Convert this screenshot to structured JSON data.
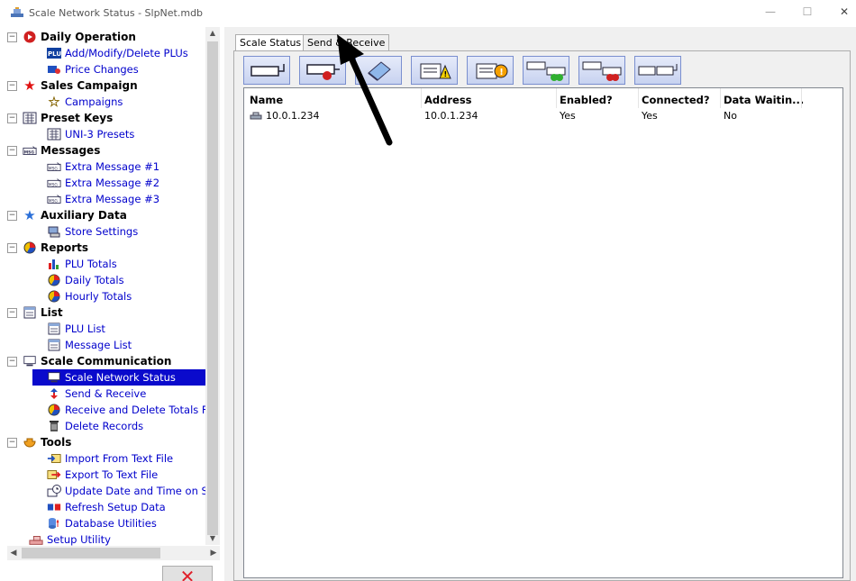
{
  "window": {
    "title": "Scale Network Status - SlpNet.mdb",
    "minimize": "—",
    "maximize": "☐",
    "close": "✕"
  },
  "tree": {
    "categories": [
      {
        "label": "Daily Operation",
        "icon": "play-icon",
        "children": [
          {
            "label": "Add/Modify/Delete PLUs",
            "icon": "plu-icon"
          },
          {
            "label": "Price Changes",
            "icon": "price-tag-icon"
          }
        ]
      },
      {
        "label": "Sales Campaign",
        "icon": "red-star-icon",
        "children": [
          {
            "label": "Campaigns",
            "icon": "yellow-star-icon"
          }
        ]
      },
      {
        "label": "Preset Keys",
        "icon": "keypad-icon",
        "children": [
          {
            "label": "UNI-3 Presets",
            "icon": "keypad-icon"
          }
        ]
      },
      {
        "label": "Messages",
        "icon": "message-icon",
        "children": [
          {
            "label": "Extra Message #1",
            "icon": "message-icon"
          },
          {
            "label": "Extra Message #2",
            "icon": "message-icon"
          },
          {
            "label": "Extra Message #3",
            "icon": "message-icon"
          }
        ]
      },
      {
        "label": "Auxiliary Data",
        "icon": "blue-star-icon",
        "children": [
          {
            "label": "Store Settings",
            "icon": "store-icon"
          }
        ]
      },
      {
        "label": "Reports",
        "icon": "pie-chart-icon",
        "children": [
          {
            "label": "PLU Totals",
            "icon": "bar-chart-icon"
          },
          {
            "label": "Daily Totals",
            "icon": "pie-chart-icon"
          },
          {
            "label": "Hourly Totals",
            "icon": "pie-chart-icon"
          }
        ]
      },
      {
        "label": "List",
        "icon": "list-icon",
        "children": [
          {
            "label": "PLU List",
            "icon": "list-icon"
          },
          {
            "label": "Message List",
            "icon": "list-icon"
          }
        ]
      },
      {
        "label": "Scale Communication",
        "icon": "network-icon",
        "children": [
          {
            "label": "Scale Network Status",
            "icon": "network-icon",
            "selected": true
          },
          {
            "label": "Send & Receive",
            "icon": "transfer-icon"
          },
          {
            "label": "Receive and Delete Totals F",
            "icon": "pie-chart-icon"
          },
          {
            "label": "Delete Records",
            "icon": "trash-icon"
          }
        ]
      },
      {
        "label": "Tools",
        "icon": "tools-icon",
        "children": [
          {
            "label": "Import From Text File",
            "icon": "import-icon"
          },
          {
            "label": "Export To Text File",
            "icon": "export-icon"
          },
          {
            "label": "Update Date and Time on S",
            "icon": "clock-icon"
          },
          {
            "label": "Refresh Setup Data",
            "icon": "refresh-icon"
          },
          {
            "label": "Database Utilities",
            "icon": "database-icon"
          }
        ]
      }
    ],
    "footer_item": {
      "label": "Setup Utility",
      "icon": "scale-icon"
    },
    "expander_symbol": "⊟"
  },
  "tabs": [
    {
      "label": "Scale Status",
      "active": true
    },
    {
      "label": "Send & Receive",
      "active": false
    }
  ],
  "toolbar": [
    {
      "icon": "scale-connect-icon"
    },
    {
      "icon": "scale-disconnect-icon"
    },
    {
      "icon": "eraser-icon"
    },
    {
      "icon": "warning-doc-icon"
    },
    {
      "icon": "alert-doc-icon"
    },
    {
      "icon": "scales-green-icon"
    },
    {
      "icon": "scales-red-icon"
    },
    {
      "icon": "scales-pair-icon"
    }
  ],
  "table": {
    "columns": [
      "Name",
      "Address",
      "Enabled?",
      "Connected?",
      "Data Waitin..."
    ],
    "rows": [
      [
        "10.0.1.234",
        "10.0.1.234",
        "Yes",
        "Yes",
        "No"
      ]
    ]
  },
  "colors": {
    "selection": "#0a0acc",
    "link_text": "#0000cc",
    "toolbar_border": "#7a8fcf",
    "close_red": "#e0202a"
  },
  "close_button_symbol": "✕"
}
